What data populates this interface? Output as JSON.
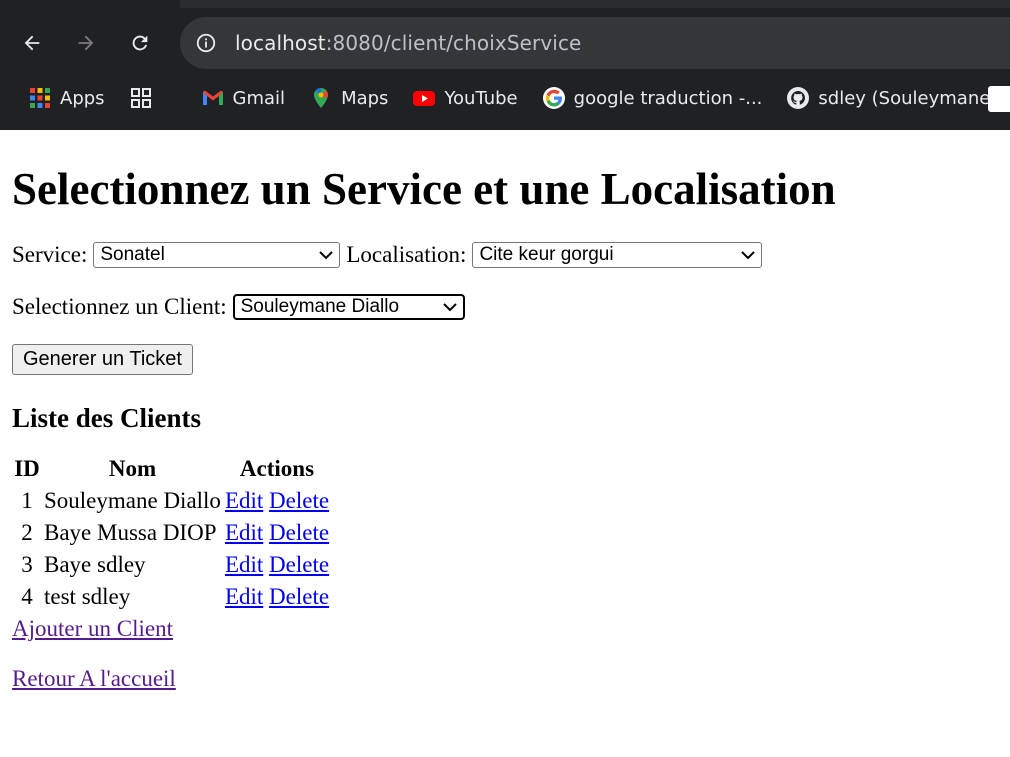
{
  "browser": {
    "url_host": "localhost",
    "url_path": ":8080/client/choixService",
    "bookmarks": [
      {
        "label": "Apps",
        "icon": "apps-grid-icon"
      },
      {
        "label": "",
        "icon": "tab-groups-icon"
      },
      {
        "label": "Gmail",
        "icon": "gmail-icon"
      },
      {
        "label": "Maps",
        "icon": "maps-icon"
      },
      {
        "label": "YouTube",
        "icon": "youtube-icon"
      },
      {
        "label": "google traduction -...",
        "icon": "google-icon"
      },
      {
        "label": "sdley (Souleymane...",
        "icon": "github-icon"
      }
    ]
  },
  "page": {
    "title": "Selectionnez un Service et une Localisation",
    "service_label": "Service:",
    "service_value": "Sonatel",
    "localisation_label": "Localisation:",
    "localisation_value": "Cite keur gorgui",
    "client_label": "Selectionnez un Client:",
    "client_value": "Souleymane Diallo",
    "generate_button": "Generer un Ticket",
    "list_title": "Liste des Clients",
    "table": {
      "headers": [
        "ID",
        "Nom",
        "Actions"
      ],
      "rows": [
        {
          "id": "1",
          "nom": "Souleymane Diallo",
          "edit": "Edit",
          "delete": "Delete"
        },
        {
          "id": "2",
          "nom": "Baye Mussa DIOP",
          "edit": "Edit",
          "delete": "Delete"
        },
        {
          "id": "3",
          "nom": "Baye sdley",
          "edit": "Edit",
          "delete": "Delete"
        },
        {
          "id": "4",
          "nom": "test sdley",
          "edit": "Edit",
          "delete": "Delete"
        }
      ]
    },
    "add_client_link": "Ajouter un Client",
    "home_link": "Retour A l'accueil"
  },
  "colors": {
    "chrome_bg": "#202124",
    "omnibox_bg": "#35363a",
    "link": "#0000ee",
    "visited_link": "#551a8b"
  }
}
